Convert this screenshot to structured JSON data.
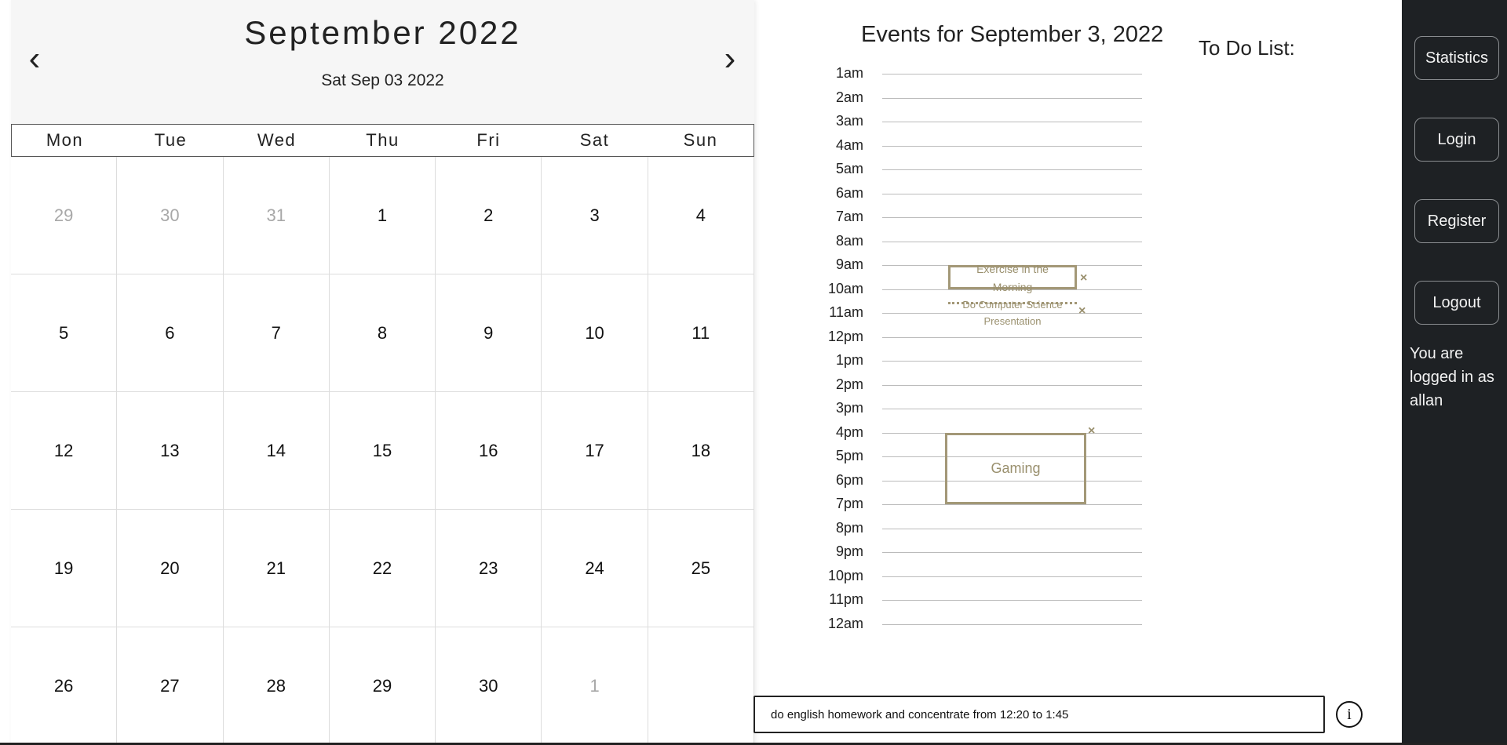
{
  "calendar": {
    "month_title": "September 2022",
    "selected_date": "Sat Sep 03 2022",
    "prev_label": "‹",
    "next_label": "›",
    "weekdays": [
      "Mon",
      "Tue",
      "Wed",
      "Thu",
      "Fri",
      "Sat",
      "Sun"
    ],
    "days": [
      {
        "n": "29",
        "other": true
      },
      {
        "n": "30",
        "other": true
      },
      {
        "n": "31",
        "other": true
      },
      {
        "n": "1"
      },
      {
        "n": "2"
      },
      {
        "n": "3"
      },
      {
        "n": "4"
      },
      {
        "n": "5"
      },
      {
        "n": "6"
      },
      {
        "n": "7"
      },
      {
        "n": "8"
      },
      {
        "n": "9"
      },
      {
        "n": "10"
      },
      {
        "n": "11"
      },
      {
        "n": "12"
      },
      {
        "n": "13"
      },
      {
        "n": "14"
      },
      {
        "n": "15"
      },
      {
        "n": "16"
      },
      {
        "n": "17"
      },
      {
        "n": "18"
      },
      {
        "n": "19"
      },
      {
        "n": "20"
      },
      {
        "n": "21"
      },
      {
        "n": "22"
      },
      {
        "n": "23"
      },
      {
        "n": "24"
      },
      {
        "n": "25"
      },
      {
        "n": "26"
      },
      {
        "n": "27"
      },
      {
        "n": "28"
      },
      {
        "n": "29"
      },
      {
        "n": "30"
      },
      {
        "n": "1",
        "other": true
      },
      {
        "n": ""
      }
    ]
  },
  "events": {
    "title": "Events for September 3, 2022",
    "hours": [
      "1am",
      "2am",
      "3am",
      "4am",
      "5am",
      "6am",
      "7am",
      "8am",
      "9am",
      "10am",
      "11am",
      "12pm",
      "1pm",
      "2pm",
      "3pm",
      "4pm",
      "5pm",
      "6pm",
      "7pm",
      "8pm",
      "9pm",
      "10pm",
      "11pm",
      "12am"
    ],
    "items": [
      {
        "name": "Exercise in the Morning",
        "start": 9,
        "end": 10,
        "label_line1": "Exercise in the",
        "label_line2": "Morning",
        "style": "solid"
      },
      {
        "name": "Do Computer Science Presentation",
        "start": 10.5,
        "end": 11,
        "label_line1": "Do Computer Science",
        "label_line2": "Presentation",
        "style": "dotted"
      },
      {
        "name": "Gaming",
        "start": 16,
        "end": 19,
        "label_line1": "Gaming",
        "label_line2": "",
        "style": "solid"
      }
    ],
    "close_symbol": "×",
    "color": "#a39877"
  },
  "todo": {
    "title": "To Do List:"
  },
  "input": {
    "value": "do english homework and concentrate from 12:20 to 1:45"
  },
  "info_symbol": "i",
  "sidebar": {
    "buttons": [
      "Statistics",
      "Login",
      "Register",
      "Logout"
    ],
    "status_text": "You are logged in as allan"
  }
}
